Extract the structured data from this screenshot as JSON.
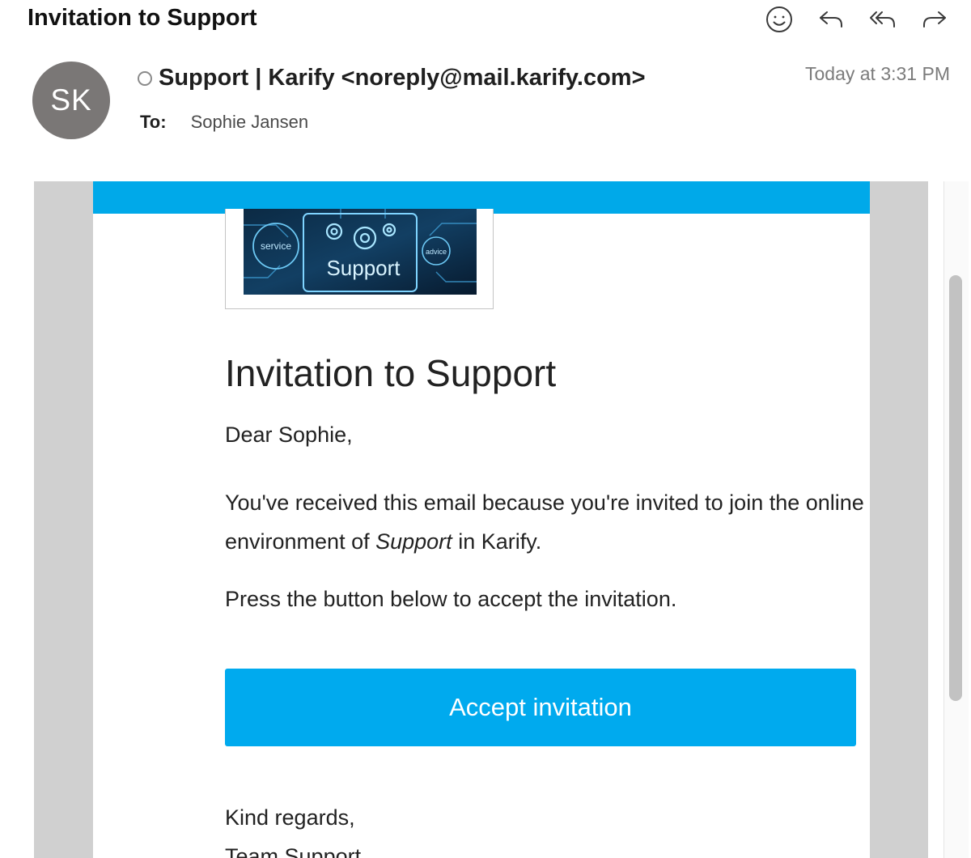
{
  "header": {
    "subject": "Invitation to Support",
    "toolbar": {
      "emoji_icon": "smiley-icon",
      "reply_icon": "reply-icon",
      "reply_all_icon": "reply-all-icon",
      "forward_icon": "forward-icon"
    },
    "avatar_initials": "SK",
    "avatar_color": "#7a7776",
    "sender": "Support | Karify <noreply@mail.karify.com>",
    "date": "Today at 3:31 PM",
    "to_label": "To:",
    "to_value": "Sophie Jansen"
  },
  "email": {
    "hero_image": {
      "label_center": "Support",
      "label_left": "service",
      "label_right": "advice"
    },
    "title": "Invitation to Support",
    "greeting": "Dear Sophie,",
    "paragraph_part1": "You've received this email because you're invited to join the online environment of ",
    "paragraph_emphasis": "Support",
    "paragraph_part2": " in Karify.",
    "instruction": "Press the button below to accept the invitation.",
    "button_label": "Accept invitation",
    "signoff_line1": "Kind regards,",
    "signoff_line2": "Team Support",
    "brand_color": "#00a9e9",
    "button_color": "#00aaee"
  }
}
